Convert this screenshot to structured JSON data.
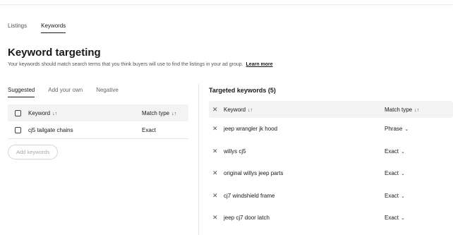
{
  "page_tabs": [
    {
      "label": "Listings",
      "active": false
    },
    {
      "label": "Keywords",
      "active": true
    }
  ],
  "heading": {
    "title": "Keyword targeting",
    "subtitle": "Your keywords should match search terms that you think buyers will use to find the listings in your ad group.",
    "learn_more": "Learn more"
  },
  "left": {
    "tabs": [
      {
        "label": "Suggested",
        "active": true
      },
      {
        "label": "Add your own",
        "active": false
      },
      {
        "label": "Negative",
        "active": false
      }
    ],
    "table": {
      "col_keyword": "Keyword",
      "col_match": "Match type",
      "sort_icon": "↓↑",
      "rows": [
        {
          "keyword": "cj5 tailgate chains",
          "match": "Exact"
        }
      ]
    },
    "add_button": "Add keywords"
  },
  "right": {
    "title": "Targeted keywords (5)",
    "table": {
      "col_keyword": "Keyword",
      "col_match": "Match type",
      "sort_icon": "↓↑",
      "remove_icon": "✕",
      "chevron_icon": "⌄",
      "rows": [
        {
          "keyword": "jeep wrangler jk hood",
          "match": "Phrase"
        },
        {
          "keyword": "willys cj5",
          "match": "Exact"
        },
        {
          "keyword": "original willys jeep parts",
          "match": "Exact"
        },
        {
          "keyword": "cj7 windshield frame",
          "match": "Exact"
        },
        {
          "keyword": "jeep cj7 door latch",
          "match": "Exact"
        }
      ]
    }
  }
}
